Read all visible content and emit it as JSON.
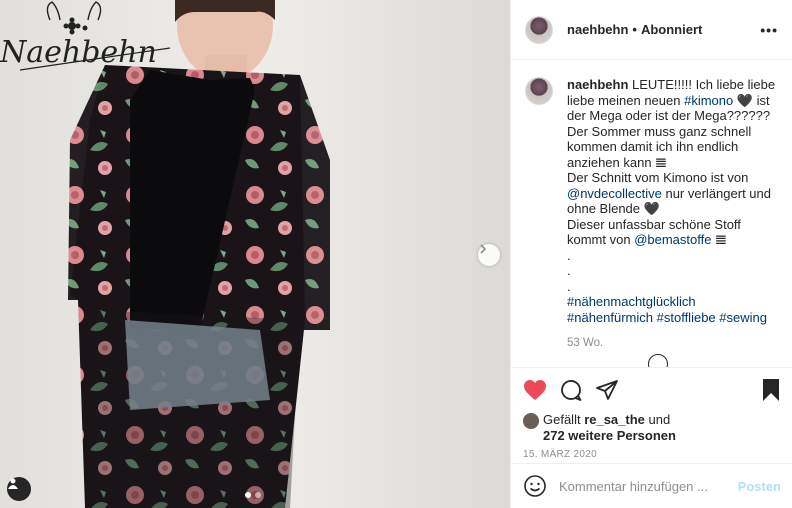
{
  "post": {
    "username": "naehbehn",
    "follow_dot": "•",
    "follow_status": "Abonniert",
    "more_icon": "•••",
    "watermark": "Naehbehn"
  },
  "caption": {
    "username": "naehbehn",
    "parts": [
      {
        "type": "text",
        "value": " LEUTE!!!!! Ich liebe liebe liebe meinen neuen "
      },
      {
        "type": "link",
        "value": "#kimono"
      },
      {
        "type": "text",
        "value": " 🖤 ist der Mega oder ist der Mega?????? Der Sommer muss ganz schnell kommen damit ich ihn endlich anziehen kann 𝌆"
      },
      {
        "type": "br"
      },
      {
        "type": "text",
        "value": "Der Schnitt vom Kimono ist von "
      },
      {
        "type": "link",
        "value": "@nvdecollective"
      },
      {
        "type": "text",
        "value": " nur verlängert und ohne Blende 🖤"
      },
      {
        "type": "br"
      },
      {
        "type": "text",
        "value": "Dieser unfassbar schöne Stoff kommt von "
      },
      {
        "type": "link",
        "value": "@bemastoffe"
      },
      {
        "type": "text",
        "value": " 𝌆"
      },
      {
        "type": "br"
      },
      {
        "type": "text",
        "value": "."
      },
      {
        "type": "br"
      },
      {
        "type": "text",
        "value": "."
      },
      {
        "type": "br"
      },
      {
        "type": "text",
        "value": "."
      },
      {
        "type": "br"
      },
      {
        "type": "link",
        "value": "#nähenmachtglücklich"
      },
      {
        "type": "text",
        "value": " "
      },
      {
        "type": "link",
        "value": "#nähenfürmich"
      },
      {
        "type": "text",
        "value": " "
      },
      {
        "type": "link",
        "value": "#stoffliebe"
      },
      {
        "type": "text",
        "value": " "
      },
      {
        "type": "link",
        "value": "#sewing"
      }
    ],
    "time_ago": "53 Wo."
  },
  "likes": {
    "prefix": "Gefällt ",
    "user": "re_sa_the",
    "connector": " und",
    "others": "272 weitere Personen"
  },
  "date": "15. März 2020",
  "comment": {
    "placeholder": "Kommentar hinzufügen ...",
    "post_label": "Posten"
  },
  "colors": {
    "like_red": "#ed4956",
    "link_blue": "#00376b",
    "post_disabled": "#b2dffc"
  },
  "carousel": {
    "total": 2,
    "active": 1
  }
}
